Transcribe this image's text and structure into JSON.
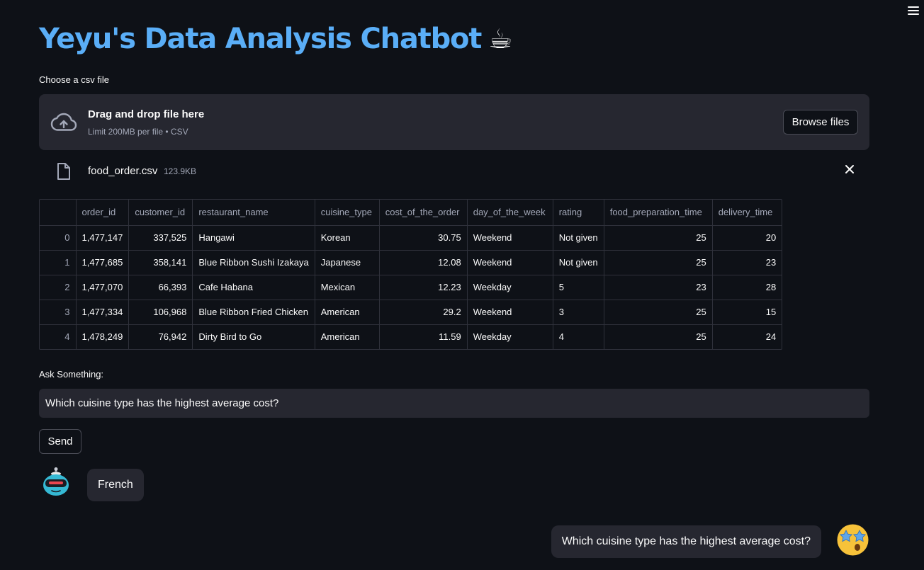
{
  "header": {
    "title": "Yeyu's Data Analysis Chatbot",
    "title_emoji": "☕",
    "menu_icon": "hamburger-menu-icon"
  },
  "uploader": {
    "label": "Choose a csv file",
    "drop_title": "Drag and drop file here",
    "drop_limit": "Limit 200MB per file • CSV",
    "browse_label": "Browse files",
    "icon": "cloud-upload-icon"
  },
  "uploaded_file": {
    "name": "food_order.csv",
    "size": "123.9KB",
    "icon": "file-icon",
    "remove_icon": "close-icon"
  },
  "table": {
    "columns": [
      "",
      "order_id",
      "customer_id",
      "restaurant_name",
      "cuisine_type",
      "cost_of_the_order",
      "day_of_the_week",
      "rating",
      "food_preparation_time",
      "delivery_time"
    ],
    "rows": [
      [
        "0",
        "1,477,147",
        "337,525",
        "Hangawi",
        "Korean",
        "30.75",
        "Weekend",
        "Not given",
        "25",
        "20"
      ],
      [
        "1",
        "1,477,685",
        "358,141",
        "Blue Ribbon Sushi Izakaya",
        "Japanese",
        "12.08",
        "Weekend",
        "Not given",
        "25",
        "23"
      ],
      [
        "2",
        "1,477,070",
        "66,393",
        "Cafe Habana",
        "Mexican",
        "12.23",
        "Weekday",
        "5",
        "23",
        "28"
      ],
      [
        "3",
        "1,477,334",
        "106,968",
        "Blue Ribbon Fried Chicken",
        "American",
        "29.2",
        "Weekend",
        "3",
        "25",
        "15"
      ],
      [
        "4",
        "1,478,249",
        "76,942",
        "Dirty Bird to Go",
        "American",
        "11.59",
        "Weekday",
        "4",
        "25",
        "24"
      ]
    ]
  },
  "ask": {
    "label": "Ask Something:",
    "value": "Which cuisine type has the highest average cost?",
    "send_label": "Send"
  },
  "chat": {
    "bot_message": "French",
    "user_message": "Which cuisine type has the highest average cost?",
    "bot_avatar": "robot-avatar-icon",
    "user_avatar": "star-struck-emoji-avatar-icon"
  },
  "colors": {
    "background": "#0e1117",
    "surface": "#262730",
    "title": "#5aaef7",
    "muted_text": "#a3a8b8"
  }
}
